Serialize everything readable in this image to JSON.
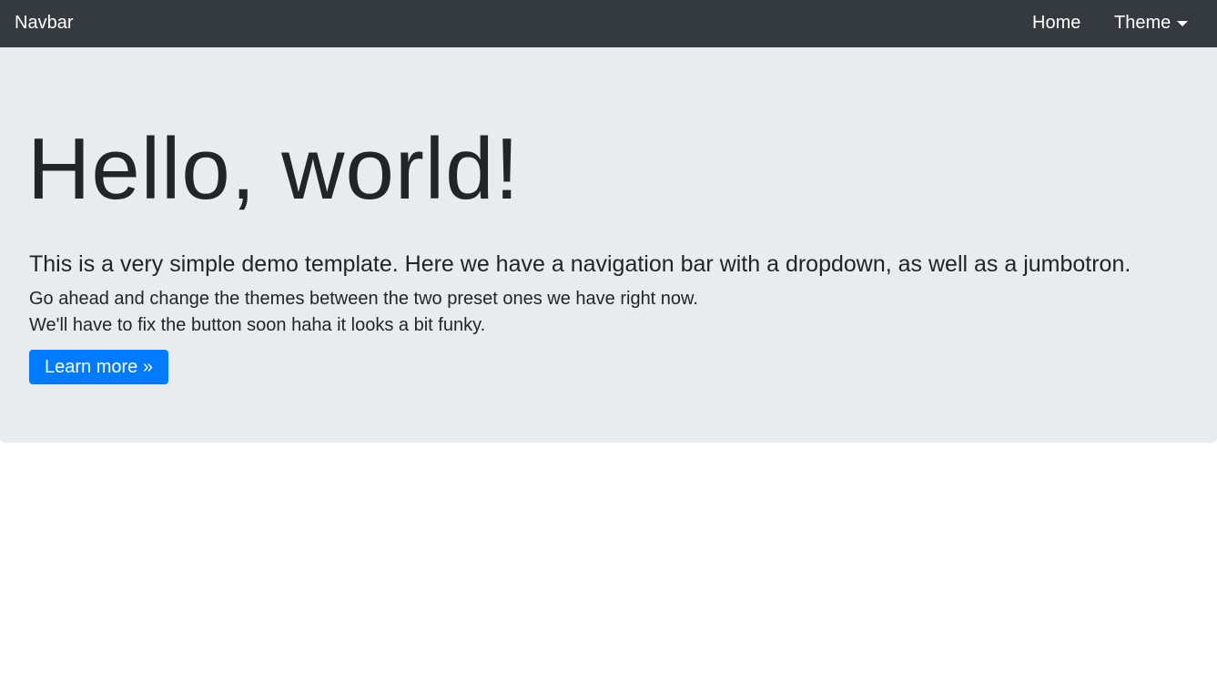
{
  "navbar": {
    "brand": "Navbar",
    "home_label": "Home",
    "theme_label": "Theme",
    "background_color": "#343a40"
  },
  "jumbotron": {
    "heading": "Hello, world!",
    "lead": "This is a very simple demo template. Here we have a navigation bar with a dropdown, as well as a jumbotron.",
    "line1": "Go ahead and change the themes between the two preset ones we have right now.",
    "line2": "We'll have to fix the button soon haha it looks a bit funky.",
    "button_label": "Learn more »",
    "background_color": "#e9ecef",
    "button_color": "#007bff"
  }
}
